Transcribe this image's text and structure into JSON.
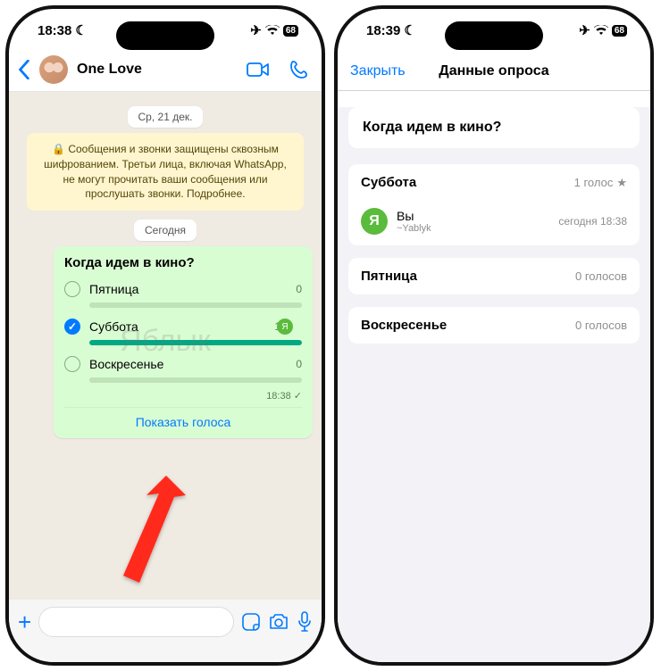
{
  "watermark": "Яблык",
  "left": {
    "status": {
      "time": "18:38",
      "moon": "☾",
      "plane": "✈︎",
      "wifi": "wifi",
      "battery": "68"
    },
    "chat": {
      "back": "back",
      "title": "One Love",
      "video": "video",
      "call": "phone"
    },
    "feed": {
      "date_pill": "Ср, 21 дек.",
      "encryption_notice": "🔒 Сообщения и звонки защищены сквозным шифрованием. Третьи лица, включая WhatsApp, не могут прочитать ваши сообщения или прослушать звонки. Подробнее.",
      "today_pill": "Сегодня",
      "poll": {
        "question": "Когда идем в кино?",
        "options": [
          {
            "label": "Пятница",
            "count": 0,
            "checked": false,
            "pct": 0
          },
          {
            "label": "Суббота",
            "count": 1,
            "checked": true,
            "pct": 100,
            "voter_initial": "Я"
          },
          {
            "label": "Воскресенье",
            "count": 0,
            "checked": false,
            "pct": 0
          }
        ],
        "time": "18:38",
        "show_votes": "Показать голоса"
      }
    },
    "composer": {
      "plus": "+",
      "sticker": "sticker",
      "camera": "camera",
      "mic": "mic"
    }
  },
  "right": {
    "status": {
      "time": "18:39",
      "moon": "☾",
      "plane": "✈︎",
      "wifi": "wifi",
      "battery": "68"
    },
    "modal": {
      "close": "Закрыть",
      "title": "Данные опроса"
    },
    "details": {
      "question": "Когда идем в кино?",
      "groups": [
        {
          "label": "Суббота",
          "count_text": "1 голос",
          "starred": true,
          "voters": [
            {
              "initial": "Я",
              "name": "Вы",
              "sub": "~Yablyk",
              "time": "сегодня 18:38"
            }
          ]
        },
        {
          "label": "Пятница",
          "count_text": "0 голосов",
          "voters": []
        },
        {
          "label": "Воскресенье",
          "count_text": "0 голосов",
          "voters": []
        }
      ]
    }
  }
}
